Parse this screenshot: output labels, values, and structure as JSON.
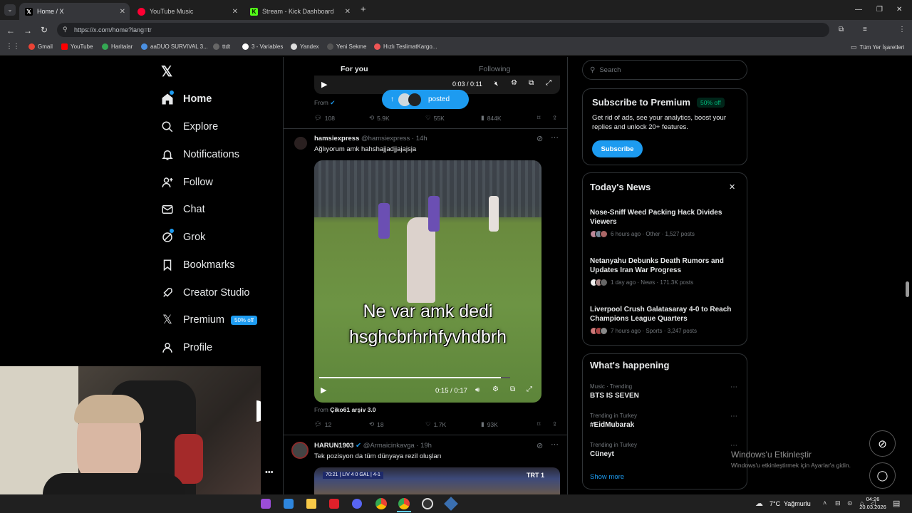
{
  "browser": {
    "tabs": [
      {
        "title": "Home / X",
        "active": true
      },
      {
        "title": "YouTube Music",
        "active": false
      },
      {
        "title": "Stream - Kick Dashboard",
        "active": false
      }
    ],
    "url": "https://x.com/home?lang=tr",
    "bookmarks": [
      "Gmail",
      "YouTube",
      "Haritalar",
      "aaDUO SURVIVAL 3...",
      "ttdt",
      "3 - Variables",
      "Yandex",
      "Yeni Sekme",
      "Hızlı TeslimatKargo..."
    ],
    "all_bookmarks": "Tüm Yer İşaretleri"
  },
  "nav": {
    "items": [
      "Home",
      "Explore",
      "Notifications",
      "Follow",
      "Chat",
      "Grok",
      "Bookmarks",
      "Creator Studio",
      "Premium",
      "Profile"
    ],
    "premium_badge": "50% off"
  },
  "feed": {
    "tabs": [
      "For you",
      "Following"
    ],
    "posted_pill": "posted",
    "top_post": {
      "time": "0:03 / 0:11",
      "from": "From",
      "replies": "108",
      "reposts": "5.9K",
      "likes": "55K",
      "views": "844K"
    },
    "post1": {
      "name": "hamsiexpress",
      "handle": "@hamsiexpress",
      "age": "· 14h",
      "text": "Ağlıyorum amk hahshajjadjjajajsja",
      "caption_line1": "Ne var amk dedi",
      "caption_line2": "hsghcbrhrhfyvhdbrh",
      "time": "0:15 / 0:17",
      "from_label": "From",
      "from_name": "Çiko61 arşiv 3.0",
      "replies": "12",
      "reposts": "18",
      "likes": "1.7K",
      "views": "93K"
    },
    "post2": {
      "name": "HARUN1903",
      "handle": "@Armaicinkavga",
      "age": "· 19h",
      "text": "Tek pozisyon da tüm dünyaya rezil oluşları",
      "score": "70:21 | LIV 4 0 GAL | 4-1",
      "channel": "TRT 1"
    }
  },
  "sidebar": {
    "search_placeholder": "Search",
    "premium": {
      "title": "Subscribe to Premium",
      "badge": "50% off",
      "body": "Get rid of ads, see your analytics, boost your replies and unlock 20+ features.",
      "button": "Subscribe"
    },
    "news": {
      "title": "Today's News",
      "items": [
        {
          "headline": "Nose-Sniff Weed Packing Hack Divides Viewers",
          "meta": "6 hours ago · Other · 1,527 posts"
        },
        {
          "headline": "Netanyahu Debunks Death Rumors and Updates Iran War Progress",
          "meta": "1 day ago · News · 171.3K posts"
        },
        {
          "headline": "Liverpool Crush Galatasaray 4-0 to Reach Champions League Quarters",
          "meta": "7 hours ago · Sports · 3,247 posts"
        }
      ]
    },
    "happening": {
      "title": "What's happening",
      "items": [
        {
          "context": "Music · Trending",
          "topic": "BTS IS SEVEN"
        },
        {
          "context": "Trending in Turkey",
          "topic": "#EidMubarak"
        },
        {
          "context": "Trending in Turkey",
          "topic": "Cüneyt"
        }
      ],
      "show_more": "Show more"
    }
  },
  "activation": {
    "title": "Windows'u Etkinleştir",
    "body": "Windows'u etkinleştirmek için Ayarlar'a gidin."
  },
  "taskbar": {
    "weather": "7°C  Yağmurlu",
    "time": "04:26",
    "date": "20.03.2026"
  },
  "colors": {
    "accent": "#1d9bf0",
    "badge_green": "#00ba7c",
    "muted": "#71767b"
  }
}
